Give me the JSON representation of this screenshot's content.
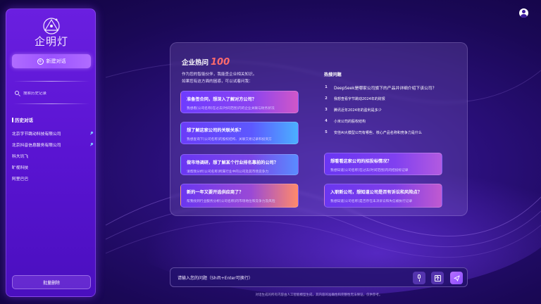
{
  "sidebar": {
    "logo_text": "企明灯",
    "new_chat_label": "新建对话",
    "search_placeholder": "搜索历史记录",
    "history_title": "历史对话",
    "history": [
      {
        "label": "北京字节跳动科技有限公司",
        "pinned": true
      },
      {
        "label": "北京抖音信息服务有限公司",
        "pinned": true
      },
      {
        "label": "科大讯飞",
        "pinned": false
      },
      {
        "label": "旷视科技",
        "pinned": false
      },
      {
        "label": "阿里巴巴",
        "pinned": false
      }
    ],
    "batch_delete_label": "批量删除"
  },
  "main": {
    "title_prefix": "企业热问",
    "title_number": "100",
    "intro_line1": "作为您的智能伙伴，我能查企业相关知识。",
    "intro_line2": "如果您有这方面的困惑，可以试着问我：",
    "cards": [
      {
        "title": "准备签合同，想深入了解对方公司？",
        "desc": "我想看[公司名称]在过去[时间范围]内的企业关联与财务状况"
      },
      {
        "title": "想了解这家公司的关联关系？",
        "desc": "我想查询下[公司名称]的股权结构、关联交易记录和投资方"
      },
      {
        "title": "做市场调研，想了解某个行业排名靠前的公司？",
        "desc": "请帮我分析[公司名称]所属行业中的公司及其市场竞争力"
      },
      {
        "title": "新的一年又要开选供应商了？",
        "desc": "帮我找到行业服务分析[公司名称]的市场地位和竞争力及风险"
      },
      {
        "title": "想看看这家公司的招投标情况？",
        "desc": "我想知道[公司名称]在过去[时间范围]内的招投标记录"
      },
      {
        "title": "入职新公司，想知道公司是否有诉讼和风险点？",
        "desc": "我想知道[公司名称]是否存在未决诉讼和失信被执行记录"
      }
    ],
    "hot_title": "热搜问题",
    "hot_questions": [
      {
        "num": "1",
        "text": "DeepSeek是哪家公司旗下的产品并详细介绍下该公司？"
      },
      {
        "num": "2",
        "text": "我想查看字节跳动2024年的财报"
      },
      {
        "num": "3",
        "text": "腾讯近年2024年的盈利是多少"
      },
      {
        "num": "4",
        "text": "小米公司的股权结构"
      },
      {
        "num": "5",
        "text": "安佳AI大模型公司有哪些、核心产品名称和竞争力是什么"
      }
    ]
  },
  "input": {
    "placeholder": "请输入您的问题（Shift+Enter可换行）"
  },
  "footer": {
    "disclaimer": "对话生成的所有内容由人工智能模型生成，其内容的准确性和完整性无法保证，仅供参考。"
  },
  "colors": {
    "accent": "#9b52ff",
    "hot_number": "#ff6b6b",
    "pin": "#7fd0ff"
  },
  "icons": {
    "logo": "lamp-triangle-icon",
    "new_chat": "plus-circle-icon",
    "search": "search-icon",
    "pin": "pin-icon",
    "user": "user-icon",
    "mic": "microphone-icon",
    "upload": "upload-icon",
    "send": "send-icon"
  }
}
